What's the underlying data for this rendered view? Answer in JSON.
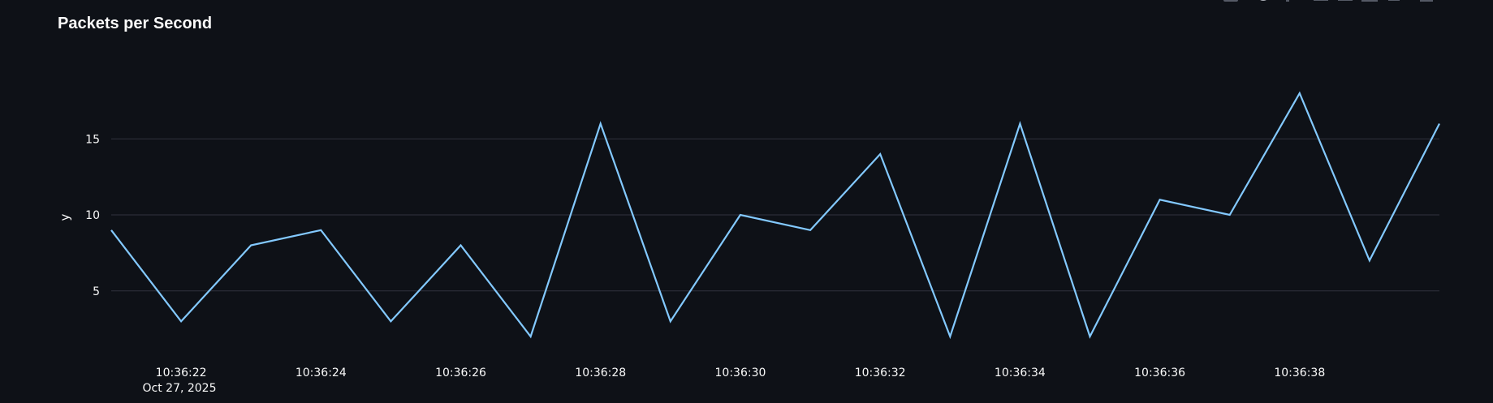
{
  "chart_data": {
    "type": "line",
    "title": "Packets per Second",
    "ylabel": "y",
    "xlabel": "",
    "date_label": "Oct 27, 2025",
    "x": [
      "10:36:21",
      "10:36:22",
      "10:36:23",
      "10:36:24",
      "10:36:25",
      "10:36:26",
      "10:36:27",
      "10:36:28",
      "10:36:29",
      "10:36:30",
      "10:36:31",
      "10:36:32",
      "10:36:33",
      "10:36:34",
      "10:36:35",
      "10:36:36",
      "10:36:37",
      "10:36:38",
      "10:36:39",
      "10:36:40"
    ],
    "xticks": [
      "10:36:22",
      "10:36:24",
      "10:36:26",
      "10:36:28",
      "10:36:30",
      "10:36:32",
      "10:36:34",
      "10:36:36",
      "10:36:38"
    ],
    "yticks": [
      5,
      10,
      15
    ],
    "ylim": [
      1.2,
      18.8
    ],
    "grid": true,
    "series": [
      {
        "values": [
          9,
          3,
          8,
          9,
          3,
          8,
          2,
          16,
          3,
          10,
          9,
          14,
          2,
          16,
          2,
          11,
          10,
          18,
          7,
          16
        ]
      }
    ]
  },
  "colors": {
    "background": "#0e1117",
    "line": "#83c9ff",
    "grid": "#31333f",
    "text": "#fafafa"
  },
  "toolbar": {
    "icons": [
      "camera-icon",
      "zoom-icon",
      "pan-icon",
      "zoom-in-icon",
      "zoom-out-icon",
      "autoscale-icon",
      "reset-axes-icon",
      "fullscreen-icon"
    ]
  }
}
